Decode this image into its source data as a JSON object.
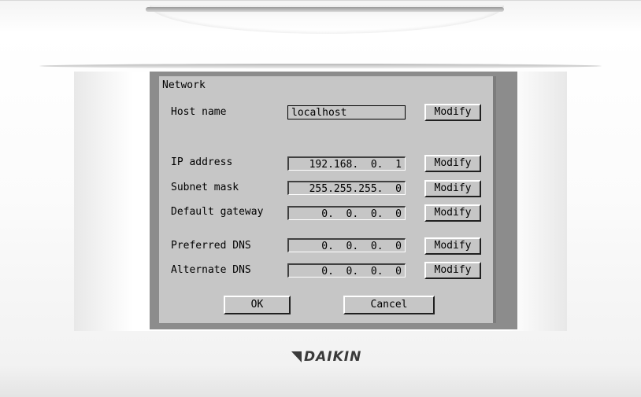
{
  "window": {
    "title": "Network"
  },
  "host_name": {
    "label": "Host name",
    "value": "localhost",
    "button": "Modify"
  },
  "ip_address": {
    "label": "IP address",
    "value": "192.168.  0.  1",
    "button": "Modify"
  },
  "subnet_mask": {
    "label": "Subnet mask",
    "value": "255.255.255.  0",
    "button": "Modify"
  },
  "default_gateway": {
    "label": "Default gateway",
    "value": "0.  0.  0.  0",
    "button": "Modify"
  },
  "preferred_dns": {
    "label": "Preferred DNS",
    "value": "0.  0.  0.  0",
    "button": "Modify"
  },
  "alternate_dns": {
    "label": "Alternate DNS",
    "value": "0.  0.  0.  0",
    "button": "Modify"
  },
  "actions": {
    "ok": "OK",
    "cancel": "Cancel"
  },
  "brand": {
    "name": "DAIKIN",
    "logo_icon": "daikin-triangle-icon",
    "color": "#3a3a3a"
  },
  "colors": {
    "screen_bg": "#c6c6c6",
    "screen_frame": "#8c8c8c"
  }
}
